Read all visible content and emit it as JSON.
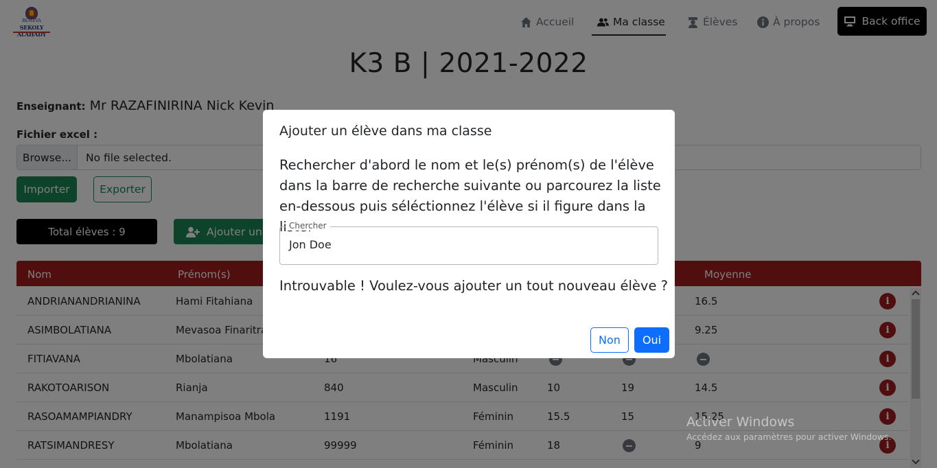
{
  "logo": {
    "line1": "REMEVA",
    "line2": "SEKOLY ALAHADY"
  },
  "nav": {
    "home": "Accueil",
    "my_class": "Ma classe",
    "students": "Élèves",
    "about": "À propos",
    "back_office": "Back office"
  },
  "page": {
    "title": "K3 B | 2021-2022"
  },
  "teacher": {
    "label": "Enseignant:",
    "name": "Mr RAZAFINIRINA Nick Kevin"
  },
  "excel": {
    "label": "Fichier excel :",
    "browse": "Browse...",
    "file_name": "No file selected.",
    "import": "Importer",
    "export": "Exporter"
  },
  "summary": {
    "total": "Total élèves : 9",
    "add_button": "Ajouter un élève"
  },
  "table": {
    "headers": {
      "nom": "Nom",
      "prenom": "Prénom(s)",
      "moyenne": "Moyenne"
    },
    "rows": [
      {
        "nom": "ANDRIANANDRIANINA",
        "prenom": "Hami Fitahiana",
        "num": "",
        "genre": "",
        "n1": "",
        "n2": "",
        "moy": "16.5"
      },
      {
        "nom": "ASIMBOLATIANA",
        "prenom": "Mevasoa Finaritra",
        "num": "",
        "genre": "",
        "n1": "",
        "n2": "",
        "moy": "9.25"
      },
      {
        "nom": "FITIAVANA",
        "prenom": "Mbolatiana",
        "num": "16",
        "genre": "Masculin",
        "n1": "",
        "n2": "",
        "moy": ""
      },
      {
        "nom": "RAKOTOARISON",
        "prenom": "Rianja",
        "num": "840",
        "genre": "Masculin",
        "n1": "10",
        "n2": "19",
        "moy": "14.5"
      },
      {
        "nom": "RASOAMAMPIANDRY",
        "prenom": "Manampisoa Mbola",
        "num": "1191",
        "genre": "Féminin",
        "n1": "15.5",
        "n2": "15",
        "moy": "15.25"
      },
      {
        "nom": "RATSIMANDRESY",
        "prenom": "Mbolatiana",
        "num": "99999",
        "genre": "Féminin",
        "n1": "18",
        "n2": "",
        "moy": "9"
      }
    ],
    "info_glyph": "i"
  },
  "modal": {
    "title": "Ajouter un élève dans ma classe",
    "instructions": "Rechercher d'abord le nom et le(s) prénom(s) de l'élève dans la barre de recherche suivante ou parcourez la liste en-dessous puis séléctionnez l'élève si il figure dans la liste:",
    "search_label": "Chercher",
    "search_value": "Jon Doe",
    "not_found": "Introuvable ! Voulez-vous ajouter un tout nouveau élève ?",
    "no": "Non",
    "yes": "Oui"
  },
  "watermark": {
    "line1": "Activer Windows",
    "line2": "Accédez aux paramètres pour activer Windows."
  },
  "colors": {
    "primary": "#0d6efd",
    "success": "#198754",
    "table_header": "#a11d1d",
    "dark": "#000000"
  }
}
